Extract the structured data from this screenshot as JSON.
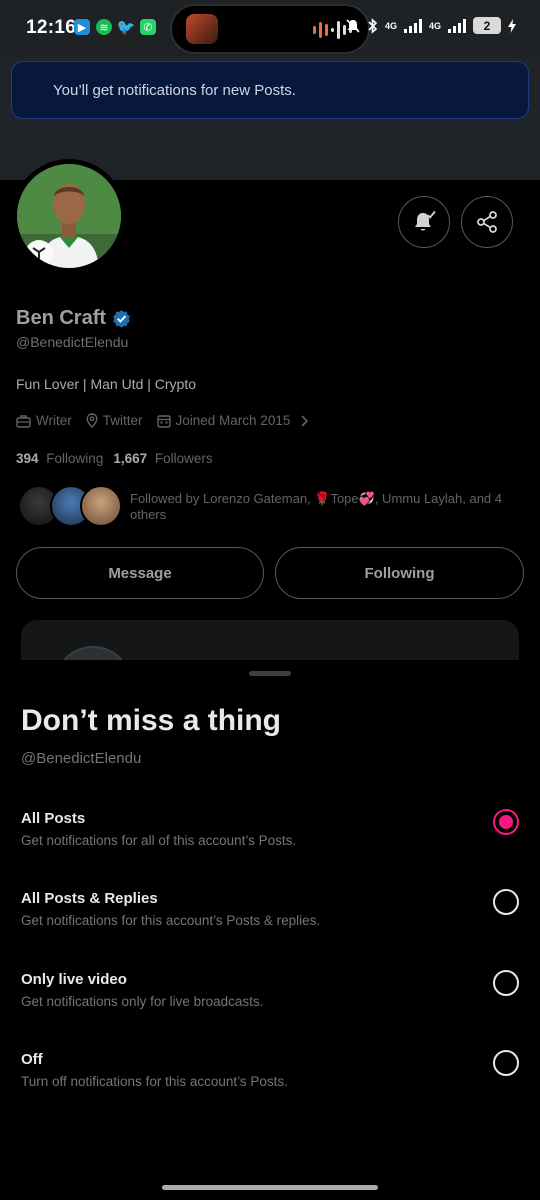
{
  "status_bar": {
    "time": "12:16",
    "network_1": "4G",
    "network_2": "4G",
    "battery": "2"
  },
  "toast": {
    "text": "You’ll get notifications for new Posts."
  },
  "profile": {
    "name": "Ben Craft",
    "handle": "@BenedictElendu",
    "bio": "Fun Lover | Man Utd | Crypto",
    "meta": {
      "job": "Writer",
      "location": "Twitter",
      "joined": "Joined March 2015"
    },
    "following_count": "394",
    "following_label": "Following",
    "followers_count": "1,667",
    "followers_label": "Followers",
    "followed_by": "Followed by Lorenzo Gateman, 🌹Tope💞, Ummu Laylah, and 4 others",
    "buttons": {
      "message": "Message",
      "following": "Following"
    }
  },
  "sheet": {
    "title": "Don’t miss a thing",
    "handle": "@BenedictElendu",
    "selected": 0,
    "options": [
      {
        "title": "All Posts",
        "desc": "Get notifications for all of this account’s Posts."
      },
      {
        "title": "All Posts & Replies",
        "desc": "Get notifications for this account’s Posts & replies."
      },
      {
        "title": "Only live video",
        "desc": "Get notifications only for live broadcasts."
      },
      {
        "title": "Off",
        "desc": "Turn off notifications for this account’s Posts."
      }
    ]
  },
  "colors": {
    "accent_pink": "#f91880",
    "verified_blue": "#1d9bf0",
    "toast_bg": "#08183c"
  }
}
